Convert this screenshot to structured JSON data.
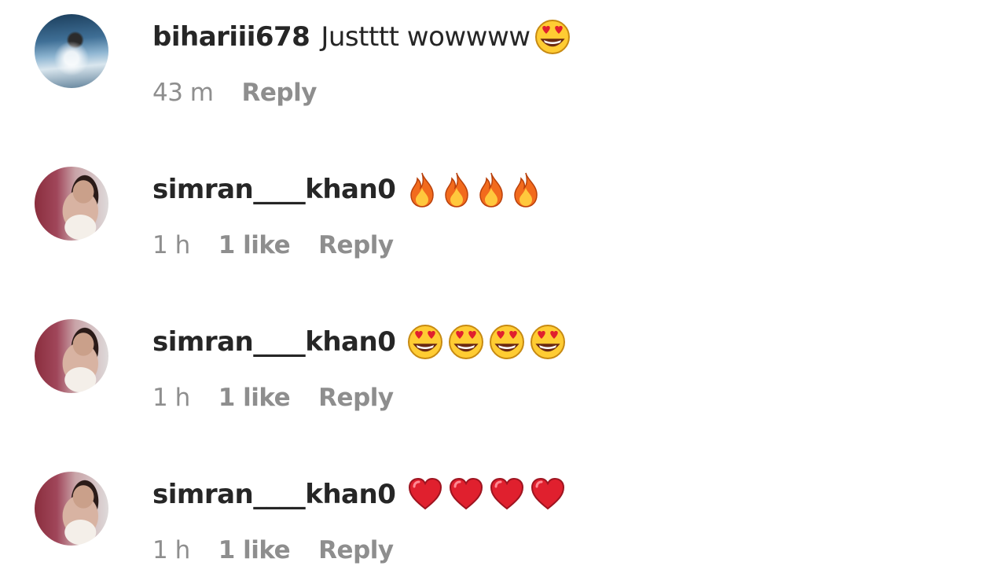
{
  "comments": [
    {
      "username": "bihariii678",
      "text": "Justttt wowwww",
      "emojis": [
        "heart-eyes-emoji"
      ],
      "time": "43 m",
      "likes": "",
      "reply_label": "Reply"
    },
    {
      "username": "simran____khan0",
      "text": "",
      "emojis": [
        "fire-emoji",
        "fire-emoji",
        "fire-emoji",
        "fire-emoji"
      ],
      "time": "1 h",
      "likes": "1 like",
      "reply_label": "Reply"
    },
    {
      "username": "simran____khan0",
      "text": "",
      "emojis": [
        "heart-eyes-emoji",
        "heart-eyes-emoji",
        "heart-eyes-emoji",
        "heart-eyes-emoji"
      ],
      "time": "1 h",
      "likes": "1 like",
      "reply_label": "Reply"
    },
    {
      "username": "simran____khan0",
      "text": "",
      "emojis": [
        "red-heart-emoji",
        "red-heart-emoji",
        "red-heart-emoji",
        "red-heart-emoji"
      ],
      "time": "1 h",
      "likes": "1 like",
      "reply_label": "Reply"
    }
  ],
  "colors": {
    "username": "#262626",
    "meta": "#8e8e8e",
    "heart": "#e0202e",
    "flame_outer": "#f26b1d",
    "flame_inner": "#ffc83d",
    "face": "#ffcc33"
  }
}
